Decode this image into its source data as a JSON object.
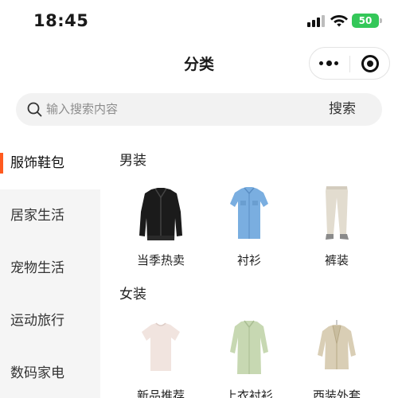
{
  "status_bar": {
    "time": "18:45",
    "battery": "50"
  },
  "nav": {
    "title": "分类"
  },
  "search": {
    "placeholder": "输入搜索内容",
    "button_label": "搜索"
  },
  "sidebar": {
    "items": [
      {
        "label": "服饰鞋包",
        "active": true
      },
      {
        "label": "居家生活",
        "active": false
      },
      {
        "label": "宠物生活",
        "active": false
      },
      {
        "label": "运动旅行",
        "active": false
      },
      {
        "label": "数码家电",
        "active": false
      }
    ]
  },
  "sections": [
    {
      "title": "男装",
      "products": [
        {
          "label": "当季热卖",
          "image": "black-leather-jacket"
        },
        {
          "label": "衬衫",
          "image": "blue-shirt"
        },
        {
          "label": "裤装",
          "image": "beige-trousers"
        }
      ]
    },
    {
      "title": "女装",
      "products": [
        {
          "label": "新品推荐",
          "image": "pink-tshirt"
        },
        {
          "label": "上衣衬衫",
          "image": "green-shirt"
        },
        {
          "label": "西装外套",
          "image": "beige-blazer"
        }
      ]
    }
  ],
  "colors": {
    "accent": "#ff5a1f",
    "sidebar_bg": "#f5f5f5",
    "search_bg": "#f2f2f2",
    "battery": "#34c759"
  }
}
